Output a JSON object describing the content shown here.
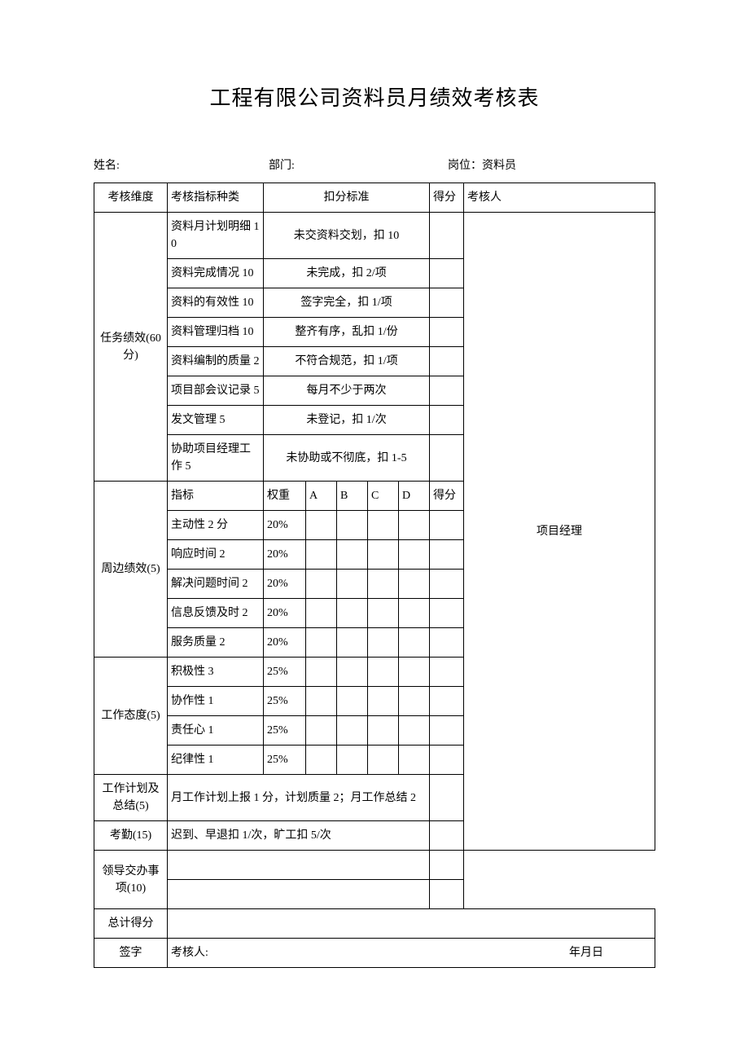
{
  "title": "工程有限公司资料员月绩效考核表",
  "info": {
    "name_label": "姓名:",
    "dept_label": "部门:",
    "pos_label": "岗位：",
    "pos_value": "资料员"
  },
  "header": {
    "dim": "考核维度",
    "indicator": "考核指标种类",
    "deduction": "扣分标准",
    "score": "得分",
    "reviewer": "考核人"
  },
  "task": {
    "dim": "任务绩效(60分)",
    "rows": [
      {
        "indicator": "资料月计划明细 10",
        "std": "未交资料交划，扣 10"
      },
      {
        "indicator": "资料完成情况 10",
        "std": "未完成，扣 2/项"
      },
      {
        "indicator": "资料的有效性 10",
        "std": "签字完全，扣 1/项"
      },
      {
        "indicator": "资料管理归档 10",
        "std": "整齐有序，乱扣 1/份"
      },
      {
        "indicator": "资料编制的质量 2",
        "std": "不符合规范，扣 1/项"
      },
      {
        "indicator": "项目部会议记录 5",
        "std": "每月不少于两次"
      },
      {
        "indicator": "发文管理 5",
        "std": "未登记，扣 1/次"
      },
      {
        "indicator": "协助项目经理工作 5",
        "std": "未协助或不彻底，扣 1-5"
      }
    ]
  },
  "peripheral": {
    "dim": "周边绩效(5)",
    "header": {
      "indicator": "指标",
      "weight": "权重",
      "a": "A",
      "b": "B",
      "c": "C",
      "d": "D",
      "score": "得分"
    },
    "rows": [
      {
        "indicator": "主动性 2 分",
        "weight": "20%"
      },
      {
        "indicator": "响应时间 2",
        "weight": "20%"
      },
      {
        "indicator": "解决问题时间 2",
        "weight": "20%"
      },
      {
        "indicator": "信息反馈及时 2",
        "weight": "20%"
      },
      {
        "indicator": "服务质量 2",
        "weight": "20%"
      }
    ]
  },
  "attitude": {
    "dim": "工作态度(5)",
    "rows": [
      {
        "indicator": "积极性 3",
        "weight": "25%"
      },
      {
        "indicator": "协作性 1",
        "weight": "25%"
      },
      {
        "indicator": "责任心 1",
        "weight": "25%"
      },
      {
        "indicator": "纪律性 1",
        "weight": "25%"
      }
    ]
  },
  "plan": {
    "dim": "工作计划及总结(5)",
    "desc": "月工作计划上报 1 分，计划质量 2；月工作总结 2"
  },
  "attendance": {
    "dim": "考勤(15)",
    "desc": "迟到、早退扣 1/次，旷工扣 5/次"
  },
  "assigned": {
    "dim": "领导交办事项(10)"
  },
  "total": {
    "dim": "总计得分"
  },
  "sign": {
    "dim": "签字",
    "reviewer": "考核人:",
    "date": "年月日"
  },
  "reviewer_name": "项目经理"
}
